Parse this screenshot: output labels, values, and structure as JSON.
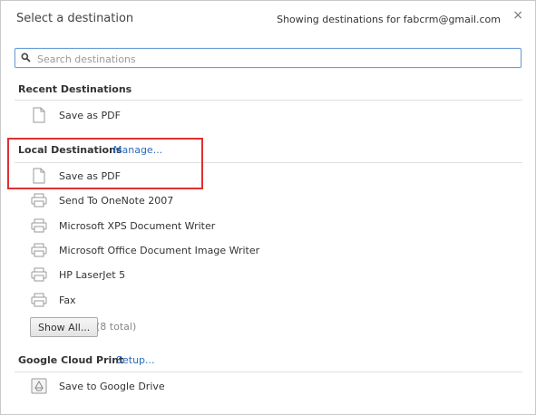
{
  "header": {
    "title": "Select a destination",
    "account_text": "Showing destinations for fabcrm@gmail.com",
    "close_symbol": "×"
  },
  "search": {
    "placeholder": "Search destinations",
    "value": ""
  },
  "sections": {
    "recent": {
      "title": "Recent Destinations",
      "items": [
        {
          "label": "Save as PDF",
          "icon": "pdf-document-icon"
        }
      ]
    },
    "local": {
      "title": "Local Destinations",
      "manage_link": "Manage...",
      "items": [
        {
          "label": "Save as PDF",
          "icon": "pdf-document-icon"
        },
        {
          "label": "Send To OneNote 2007",
          "icon": "printer-icon"
        },
        {
          "label": "Microsoft XPS Document Writer",
          "icon": "printer-icon"
        },
        {
          "label": "Microsoft Office Document Image Writer",
          "icon": "printer-icon"
        },
        {
          "label": "HP LaserJet 5",
          "icon": "printer-icon"
        },
        {
          "label": "Fax",
          "icon": "printer-icon"
        }
      ],
      "show_all_label": "Show All...",
      "total_text": "(8 total)"
    },
    "cloud": {
      "title": "Google Cloud Print",
      "setup_link": "Setup...",
      "items": [
        {
          "label": "Save to Google Drive",
          "icon": "google-drive-icon"
        }
      ]
    }
  },
  "colors": {
    "link": "#2a6bbd",
    "highlight_border": "#e03030",
    "search_border": "#6a9fd8"
  }
}
